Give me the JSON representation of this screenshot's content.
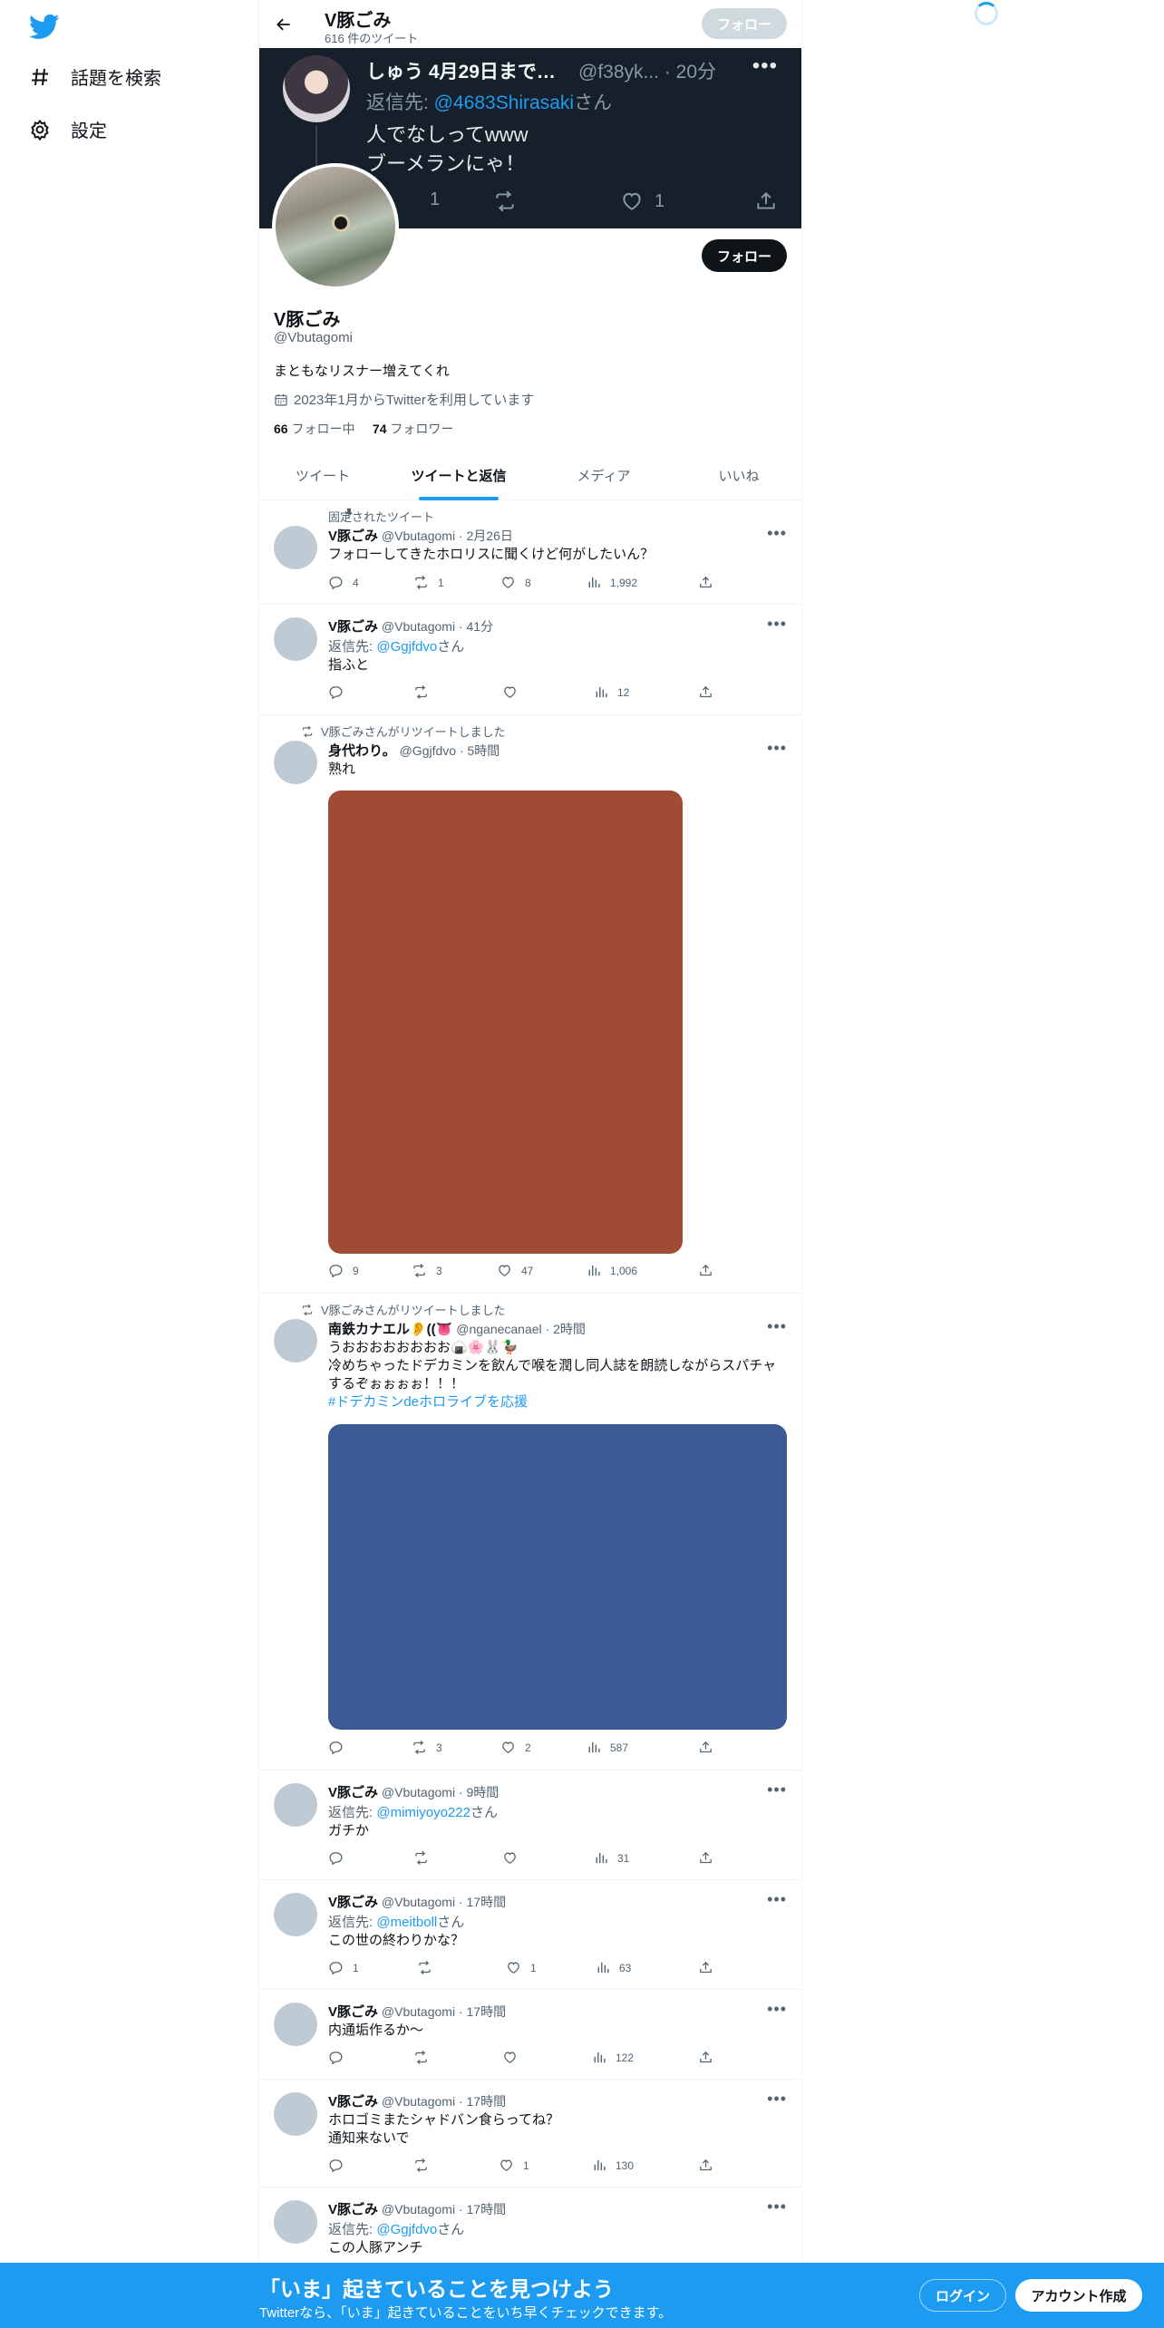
{
  "nav": {
    "explore_label": "話題を検索",
    "settings_label": "設定"
  },
  "header": {
    "name": "V豚ごみ",
    "tweet_count": "616 件のツイート",
    "follow_label": "フォロー"
  },
  "banner_tweet": {
    "name": "しゅう 4月29日まで…",
    "handle": "@f38yk...",
    "time": "· 20分",
    "reply_prefix": "返信先: ",
    "reply_user": "@4683Shirasaki",
    "reply_suffix": "さん",
    "line1": "人でなしってwww",
    "line2": "ブーメランにゃ！",
    "replies": "1",
    "likes": "1"
  },
  "profile": {
    "name": "V豚ごみ",
    "handle": "@Vbutagomi",
    "bio": "まともなリスナー増えてくれ",
    "joined": "2023年1月からTwitterを利用しています",
    "following_count": "66",
    "following_label": "フォロー中",
    "followers_count": "74",
    "followers_label": "フォロワー",
    "follow_label": "フォロー"
  },
  "tabs": [
    "ツイート",
    "ツイートと返信",
    "メディア",
    "いいね"
  ],
  "tweets": [
    {
      "context": "固定されたツイート",
      "name": "V豚ごみ",
      "handle": "@Vbutagomi",
      "time": "· 2月26日",
      "text": "フォローしてきたホロリスに聞くけど何がしたいん？",
      "replies": "4",
      "retweets": "1",
      "likes": "8",
      "views": "1,992"
    },
    {
      "name": "V豚ごみ",
      "handle": "@Vbutagomi",
      "time": "· 41分",
      "reply_prefix": "返信先: ",
      "reply_user": "@Ggjfdvo",
      "reply_suffix": "さん",
      "text": "指ふと",
      "replies": "",
      "retweets": "",
      "likes": "",
      "views": "12"
    },
    {
      "context": "V豚ごみさんがリツイートしました",
      "name": "身代わり。",
      "handle": "@Ggjfdvo",
      "time": "· 5時間",
      "text": "熟れ",
      "media_color": "#a04c34",
      "replies": "9",
      "retweets": "3",
      "likes": "47",
      "views": "1,006"
    },
    {
      "context": "V豚ごみさんがリツイートしました",
      "name": "南鉄カナエル👂((👅",
      "handle": "@nganecanael",
      "time": "· 2時間",
      "text1": "うおおおおおおおお🍙🌸🐰🦆",
      "text2": "冷めちゃったドデカミンを飲んで喉を潤し同人誌を朗読しながらスパチャ",
      "text3": "するぞぉぉぉぉ！！！",
      "hashtag": "#ドデカミンdeホロライブを応援",
      "media_color": "#3c5a94",
      "replies": "",
      "retweets": "3",
      "likes": "2",
      "views": "587"
    },
    {
      "name": "V豚ごみ",
      "handle": "@Vbutagomi",
      "time": "· 9時間",
      "reply_prefix": "返信先: ",
      "reply_user": "@mimiyoyo222",
      "reply_suffix": "さん",
      "text": "ガチか",
      "replies": "",
      "retweets": "",
      "likes": "",
      "views": "31"
    },
    {
      "name": "V豚ごみ",
      "handle": "@Vbutagomi",
      "time": "· 17時間",
      "reply_prefix": "返信先: ",
      "reply_user": "@meitboll",
      "reply_suffix": "さん",
      "text": "この世の終わりかな？",
      "replies": "1",
      "retweets": "",
      "likes": "1",
      "views": "63"
    },
    {
      "name": "V豚ごみ",
      "handle": "@Vbutagomi",
      "time": "· 17時間",
      "text": "内通垢作るか〜",
      "replies": "",
      "retweets": "",
      "likes": "",
      "views": "122"
    },
    {
      "name": "V豚ごみ",
      "handle": "@Vbutagomi",
      "time": "· 17時間",
      "text1": "ホロゴミまたシャドバン食らってね？",
      "text2": "通知来ないで",
      "replies": "",
      "retweets": "",
      "likes": "1",
      "views": "130"
    },
    {
      "name": "V豚ごみ",
      "handle": "@Vbutagomi",
      "time": "· 17時間",
      "reply_prefix": "返信先: ",
      "reply_user": "@Ggjfdvo",
      "reply_suffix": "さん",
      "text": "この人豚アンチ"
    }
  ],
  "bottom": {
    "title": "「いま」起きていることを見つけよう",
    "subtitle": "Twitterなら、「いま」起きていることをいち早くチェックできます。",
    "login": "ログイン",
    "signup": "アカウント作成"
  },
  "colors": {
    "accent": "#1d9bf0",
    "banner_bg": "#15202b"
  }
}
